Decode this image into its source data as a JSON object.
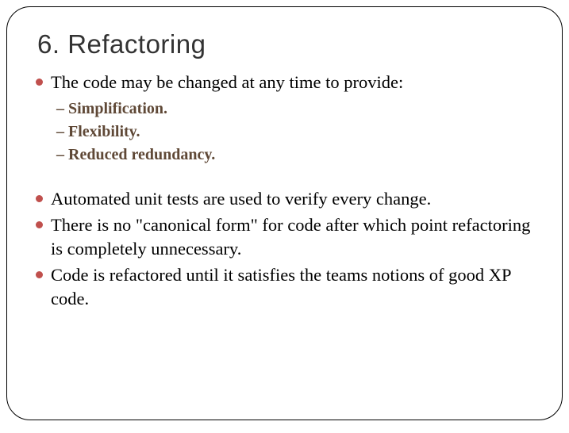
{
  "title": "6. Refactoring",
  "bullets": {
    "b1": "The code may be changed at any time to provide:",
    "b2": "Automated unit tests are used to verify every change.",
    "b3": "There is no \"canonical form\" for code after which point refactoring is completely unnecessary.",
    "b4": "Code is refactored until it satisfies the teams notions of good XP code."
  },
  "sub": {
    "s1": "– Simplification.",
    "s2": "– Flexibility.",
    "s3": "– Reduced redundancy."
  }
}
